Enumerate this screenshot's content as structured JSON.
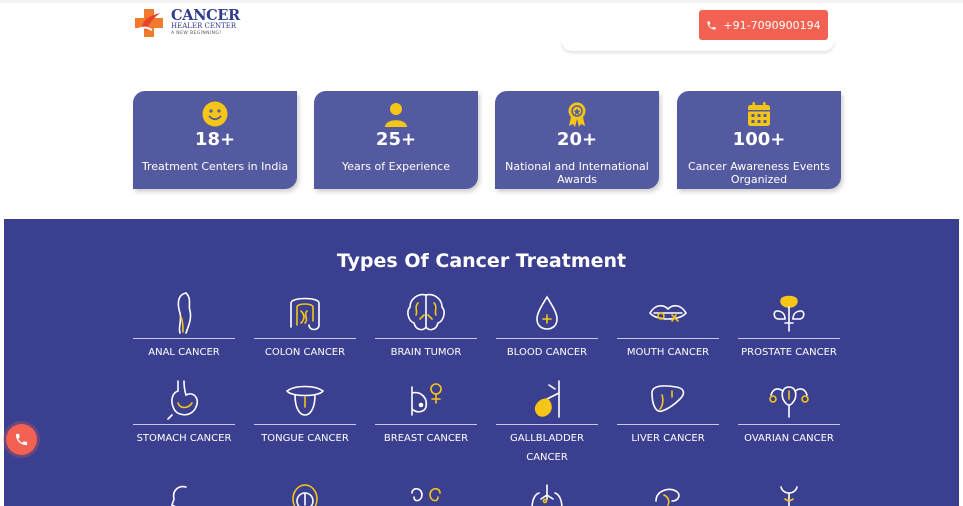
{
  "header": {
    "logo": {
      "title": "CANCER",
      "subtitle": "HEALER CENTER",
      "tagline": "A NEW BEGINNING!"
    },
    "phone": "+91-7090900194",
    "phone_icon": "phone-icon"
  },
  "stats": [
    {
      "icon": "smiley-icon",
      "value": "18+",
      "label": "Treatment Centers in India"
    },
    {
      "icon": "person-icon",
      "value": "25+",
      "label": "Years of Experience"
    },
    {
      "icon": "award-icon",
      "value": "20+",
      "label": "National and International Awards"
    },
    {
      "icon": "calendar-icon",
      "value": "100+",
      "label": "Cancer Awareness Events Organized"
    }
  ],
  "treatments": {
    "title": "Types Of Cancer Treatment",
    "items": [
      {
        "icon": "anal-icon",
        "label": "ANAL CANCER"
      },
      {
        "icon": "colon-icon",
        "label": "COLON CANCER"
      },
      {
        "icon": "brain-icon",
        "label": "BRAIN TUMOR"
      },
      {
        "icon": "blood-drop-icon",
        "label": "BLOOD CANCER"
      },
      {
        "icon": "mouth-icon",
        "label": "MOUTH CANCER"
      },
      {
        "icon": "prostate-icon",
        "label": "PROSTATE CANCER"
      },
      {
        "icon": "stomach-icon",
        "label": "STOMACH CANCER"
      },
      {
        "icon": "tongue-icon",
        "label": "TONGUE CANCER"
      },
      {
        "icon": "breast-icon",
        "label": "BREAST CANCER"
      },
      {
        "icon": "gallbladder-icon",
        "label": "GALLBLADDER CANCER"
      },
      {
        "icon": "liver-icon",
        "label": "LIVER CANCER"
      },
      {
        "icon": "ovarian-icon",
        "label": "OVARIAN CANCER"
      },
      {
        "icon": "head-icon",
        "label": ""
      },
      {
        "icon": "throat-icon",
        "label": ""
      },
      {
        "icon": "kidney-icon",
        "label": ""
      },
      {
        "icon": "lungs-icon",
        "label": ""
      },
      {
        "icon": "pancreas-icon",
        "label": ""
      },
      {
        "icon": "thyroid-icon",
        "label": ""
      }
    ]
  },
  "float_call_icon": "phone-icon",
  "colors": {
    "primary": "#3b3f8f",
    "card": "#545a9f",
    "accent": "#f26151",
    "icon_yellow": "#f5c518"
  }
}
